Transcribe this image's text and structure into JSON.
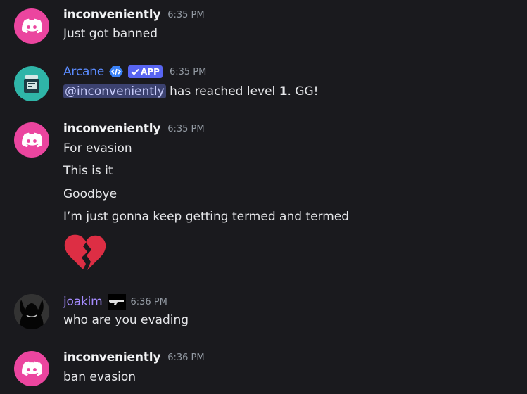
{
  "messages": [
    {
      "username": "inconveniently",
      "time": "6:35 PM",
      "lines": [
        "Just got banned"
      ]
    },
    {
      "username": "Arcane",
      "tag": "APP",
      "time": "6:35 PM",
      "mention": "@inconveniently",
      "text_before_level": " has reached level ",
      "level": "1",
      "text_after_level": ". GG!"
    },
    {
      "username": "inconveniently",
      "time": "6:35 PM",
      "lines": [
        "For evasion",
        "This is it",
        "Goodbye",
        "I’m just gonna keep getting termed and termed"
      ],
      "emoji": "broken-heart"
    },
    {
      "username": "joakim",
      "time": "6:36 PM",
      "lines": [
        "who are you evading"
      ]
    },
    {
      "username": "inconveniently",
      "time": "6:36 PM",
      "lines": [
        "ban evasion"
      ]
    }
  ],
  "colors": {
    "background": "#1a1a1e",
    "discord_avatar": "#eb459f",
    "arcane_name": "#5b8cff",
    "joakim_name": "#a58cff",
    "app_tag": "#5865f2",
    "mention_bg": "#3c4270"
  }
}
